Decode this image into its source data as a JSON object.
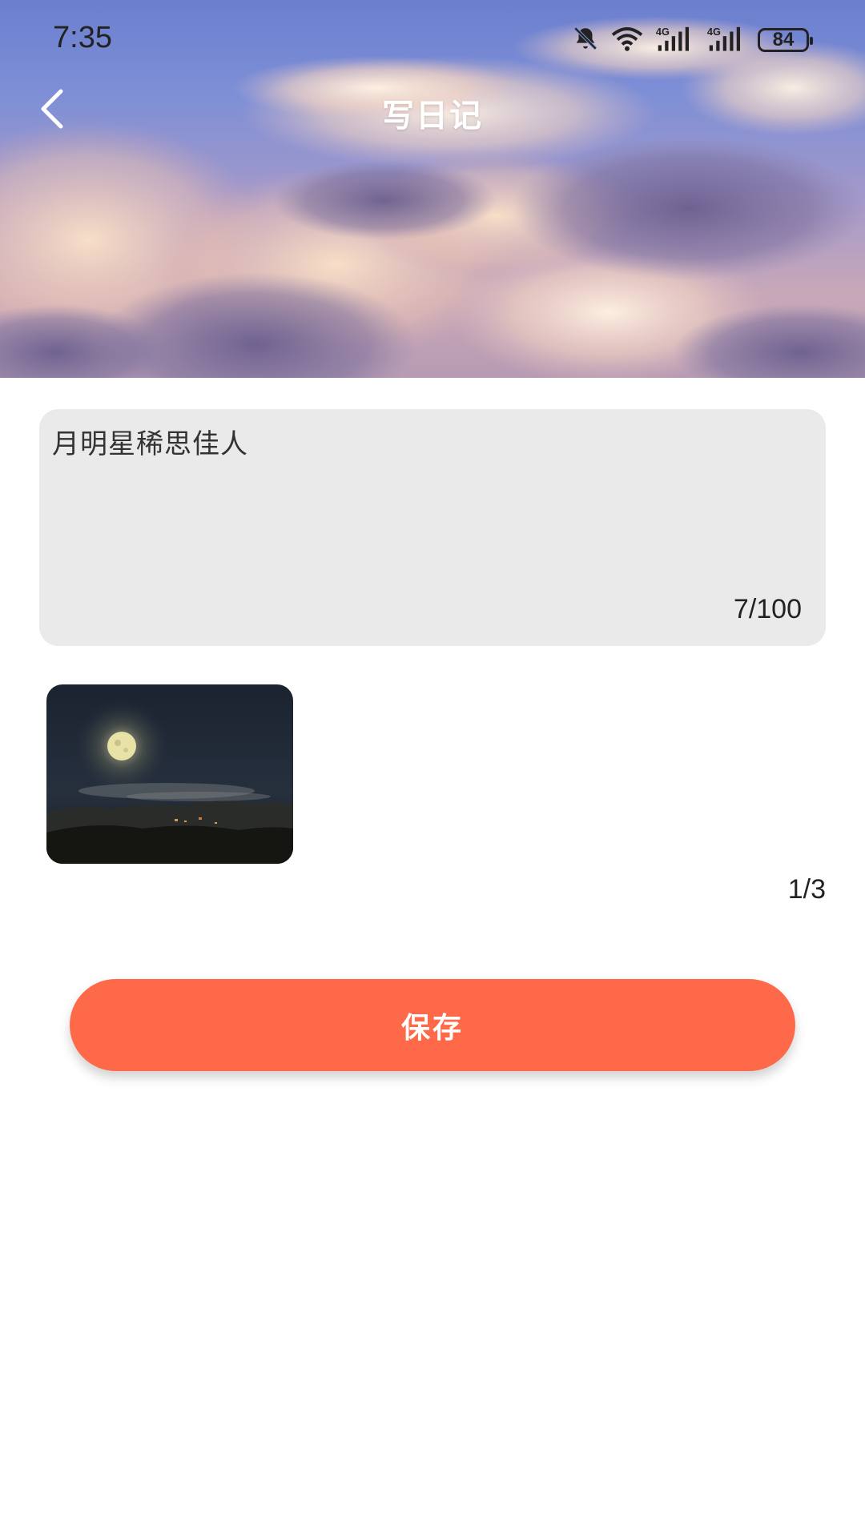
{
  "status_bar": {
    "time": "7:35",
    "battery": "84",
    "icons": [
      "mute-icon",
      "wifi-icon",
      "signal-4g-icon",
      "signal-4g-icon",
      "battery-icon"
    ]
  },
  "header": {
    "title": "写日记",
    "back_icon": "chevron-left-icon"
  },
  "editor": {
    "text": "月明星稀思佳人",
    "counter": "7/100"
  },
  "photos": {
    "counter": "1/3"
  },
  "actions": {
    "save_label": "保存"
  },
  "colors": {
    "accent": "#fe6a49",
    "text_area_bg": "#eaeaea",
    "page_bg": "#ffffff"
  }
}
